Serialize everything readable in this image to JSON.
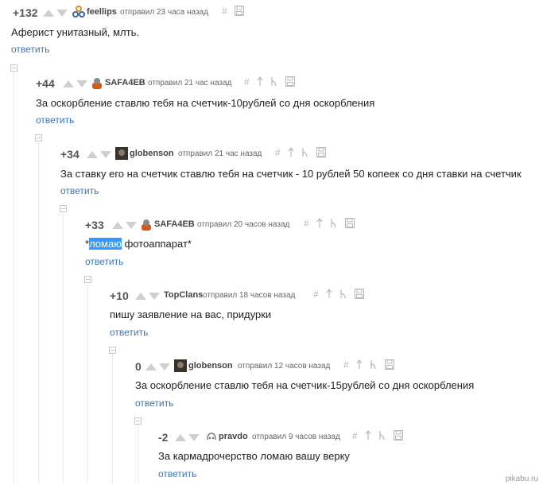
{
  "comments": [
    {
      "rating": "+132",
      "user": "feellips",
      "time": "отправил 23 часа назад",
      "text": "Аферист унитазный, млть.",
      "reply": "ответить"
    },
    {
      "rating": "+44",
      "user": "SAFA4EB",
      "time": "отправил 21 час назад",
      "text": "За оскорбление ставлю тебя на счетчик-10рублей со дня оскорбления",
      "reply": "ответить"
    },
    {
      "rating": "+34",
      "user": "globenson",
      "time": "отправил 21 час назад",
      "text": "За ставку его на счетчик ставлю тебя на счетчик - 10 рублей 50 копеек со дня ставки на счетчик",
      "reply": "ответить"
    },
    {
      "rating": "+33",
      "user": "SAFA4EB",
      "time": "отправил 20 часов назад",
      "text_before": "*",
      "text_highlight": "ломаю",
      "text_after": " фотоаппарат*",
      "reply": "ответить"
    },
    {
      "rating": "+10",
      "user": "TopClans",
      "time": "отправил 18 часов назад",
      "text": "пишу заявление на вас, придурки",
      "reply": "ответить"
    },
    {
      "rating": "0",
      "user": "globenson",
      "time": "отправил 12 часов назад",
      "text": "За оскорбление ставлю тебя на счетчик-15рублей со дня оскорбления",
      "reply": "ответить"
    },
    {
      "rating": "-2",
      "user": "pravdo",
      "time": "отправил 9 часов назад",
      "text": "За кармадрочерство ломаю вашу верку",
      "reply": "ответить"
    }
  ],
  "action_icons": {
    "link": "#",
    "parent": "arrow-up-icon",
    "branch": "branch-icon",
    "save": "save-icon"
  },
  "watermark": "pikabu.ru",
  "colors": {
    "reply_link": "#3b73b9",
    "selection": "#3399ff",
    "vote_arrow": "#cfcfcf"
  }
}
